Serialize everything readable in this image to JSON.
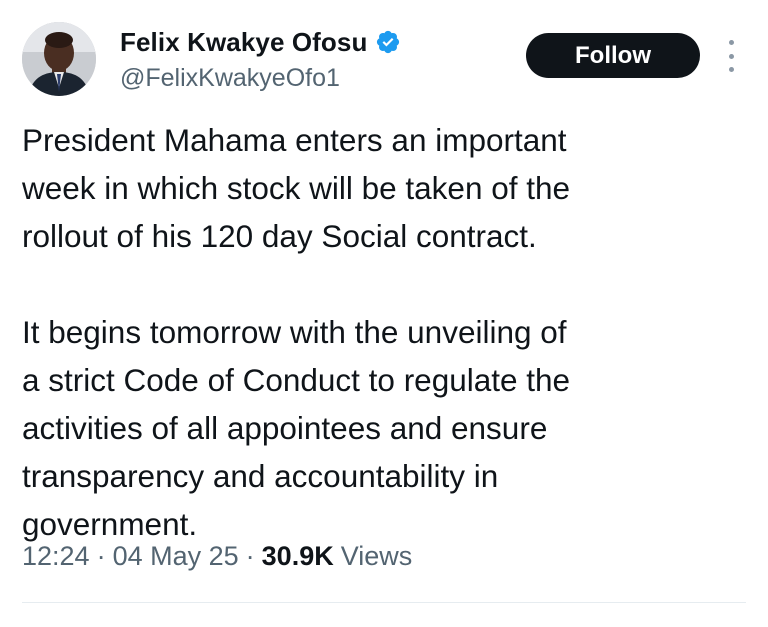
{
  "author": {
    "display_name": "Felix Kwakye Ofosu",
    "handle": "@FelixKwakyeOfo1",
    "verified": true,
    "verified_color": "#1d9bf0"
  },
  "actions": {
    "follow_label": "Follow"
  },
  "tweet": {
    "paragraphs": [
      "President Mahama enters an important\nweek in which stock will be taken of the\nrollout of his 120 day Social contract.",
      "It begins tomorrow with the unveiling of\na strict Code of Conduct to regulate the\nactivities of all appointees and ensure\ntransparency and accountability in\ngovernment."
    ]
  },
  "meta": {
    "time": "12:24",
    "separator": "·",
    "date": "04 May 25",
    "views_count": "30.9K",
    "views_label": "Views"
  },
  "colors": {
    "text": "#0f1419",
    "secondary_text": "#536471",
    "button_bg": "#0f1419",
    "button_text": "#ffffff"
  }
}
